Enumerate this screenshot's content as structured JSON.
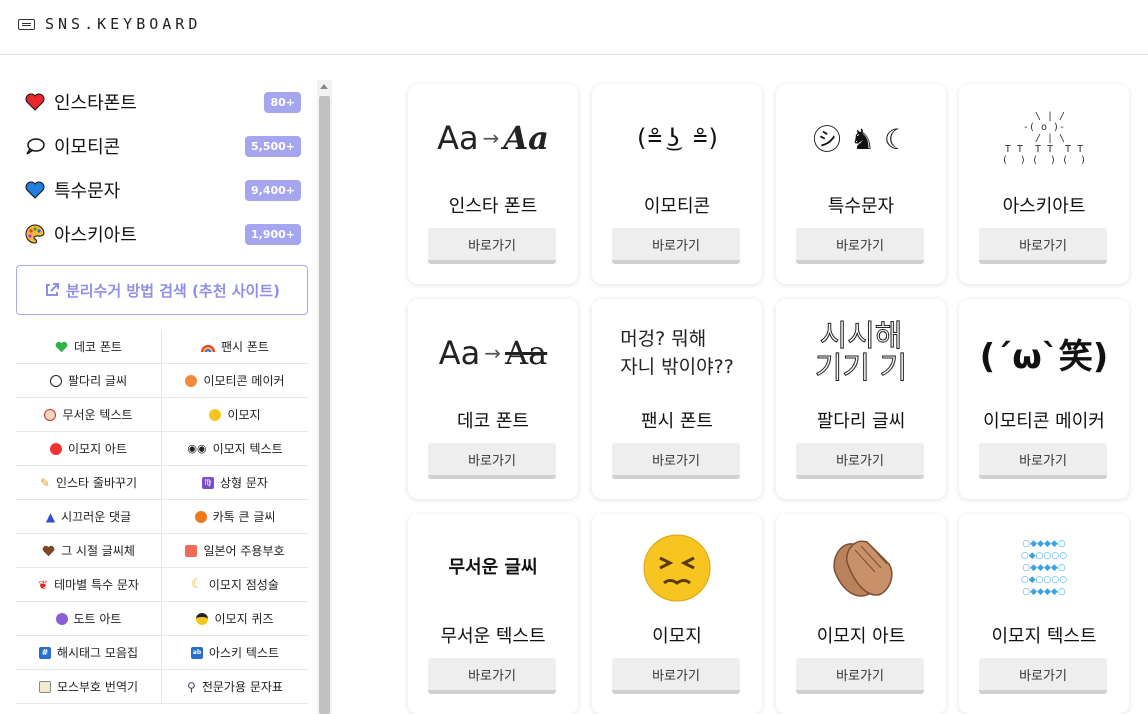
{
  "brand": {
    "name": "SNS.KEYBOARD"
  },
  "sidebar": {
    "main_items": [
      {
        "label": "인스타폰트",
        "badge": "80+",
        "icon": "heart-icon"
      },
      {
        "label": "이모티콘",
        "badge": "5,500+",
        "icon": "speech-bubble-icon"
      },
      {
        "label": "특수문자",
        "badge": "9,400+",
        "icon": "blue-heart-icon"
      },
      {
        "label": "아스키아트",
        "badge": "1,900+",
        "icon": "palette-icon"
      }
    ],
    "recycle_button": {
      "label": "분리수거 방법 검색 (추천 사이트)",
      "icon": "external-link-icon"
    },
    "links": [
      {
        "label": "데코 폰트",
        "icon": "green-heart-icon"
      },
      {
        "label": "팬시 폰트",
        "icon": "rainbow-icon"
      },
      {
        "label": "팔다리 글씨",
        "icon": "soccer-ball-icon"
      },
      {
        "label": "이모티콘 메이커",
        "icon": "planet-icon"
      },
      {
        "label": "무서운 텍스트",
        "icon": "clown-icon"
      },
      {
        "label": "이모지",
        "icon": "smiley-icon"
      },
      {
        "label": "이모지 아트",
        "icon": "lollipop-icon"
      },
      {
        "label": "이모지 텍스트",
        "icon": "eyes-icon"
      },
      {
        "label": "인스타 줄바꾸기",
        "icon": "pencil-icon"
      },
      {
        "label": "상형 문자",
        "icon": "zodiac-icon"
      },
      {
        "label": "시끄러운 댓글",
        "icon": "party-hat-icon"
      },
      {
        "label": "카톡 큰 글씨",
        "icon": "pumpkin-icon"
      },
      {
        "label": "그 시절 글씨체",
        "icon": "brown-heart-icon"
      },
      {
        "label": "일본어 주용부호",
        "icon": "sushi-icon"
      },
      {
        "label": "테마별 특수 문자",
        "icon": "feather-icon"
      },
      {
        "label": "이모지 점성술",
        "icon": "moon-icon"
      },
      {
        "label": "도트 아트",
        "icon": "crystal-ball-icon"
      },
      {
        "label": "이모지 퀴즈",
        "icon": "sunglasses-icon"
      },
      {
        "label": "해시태그 모음집",
        "icon": "hash-icon"
      },
      {
        "label": "아스키 텍스트",
        "icon": "abcd-icon"
      },
      {
        "label": "모스부호 번역기",
        "icon": "document-icon"
      },
      {
        "label": "전문가용 문자표",
        "icon": "magnifier-icon"
      }
    ]
  },
  "cards": [
    {
      "title": "인스타 폰트",
      "button": "바로가기",
      "art_left": "Aa",
      "art_right": "Aa"
    },
    {
      "title": "이모티콘",
      "button": "바로가기",
      "art": "(≗ ͜ʖ ≗)"
    },
    {
      "title": "특수문자",
      "button": "바로가기",
      "art": "㋛ ♞ ☾"
    },
    {
      "title": "아스키아트",
      "button": "바로가기",
      "art": "  \\ | /\n-( o )-\n  / | \\\nT T  T T  T T\n(  ) (  ) (  )"
    },
    {
      "title": "데코 폰트",
      "button": "바로가기",
      "art_left": "Aa",
      "art_right": "Aa"
    },
    {
      "title": "팬시 폰트",
      "button": "바로가기",
      "art_line1": "머겅? 뭐해",
      "art_line2": "자니 밖이야??"
    },
    {
      "title": "팔다리 글씨",
      "button": "바로가기",
      "art_line1": "시시해",
      "art_line2": "기기 기"
    },
    {
      "title": "이모티콘 메이커",
      "button": "바로가기",
      "art": "(´ω`笑)"
    },
    {
      "title": "무서운 텍스트",
      "button": "바로가기",
      "art": "무서운 글씨"
    },
    {
      "title": "이모지",
      "button": "바로가기",
      "icon": "persevering-face-icon"
    },
    {
      "title": "이모지 아트",
      "button": "바로가기",
      "icon": "clapping-hands-icon"
    },
    {
      "title": "이모지 텍스트",
      "button": "바로가기",
      "art": "○◆◆◆◆○\n○◆○○○○\n○◆◆◆◆○\n○◆○○○○\n○◆◆◆◆○"
    }
  ]
}
